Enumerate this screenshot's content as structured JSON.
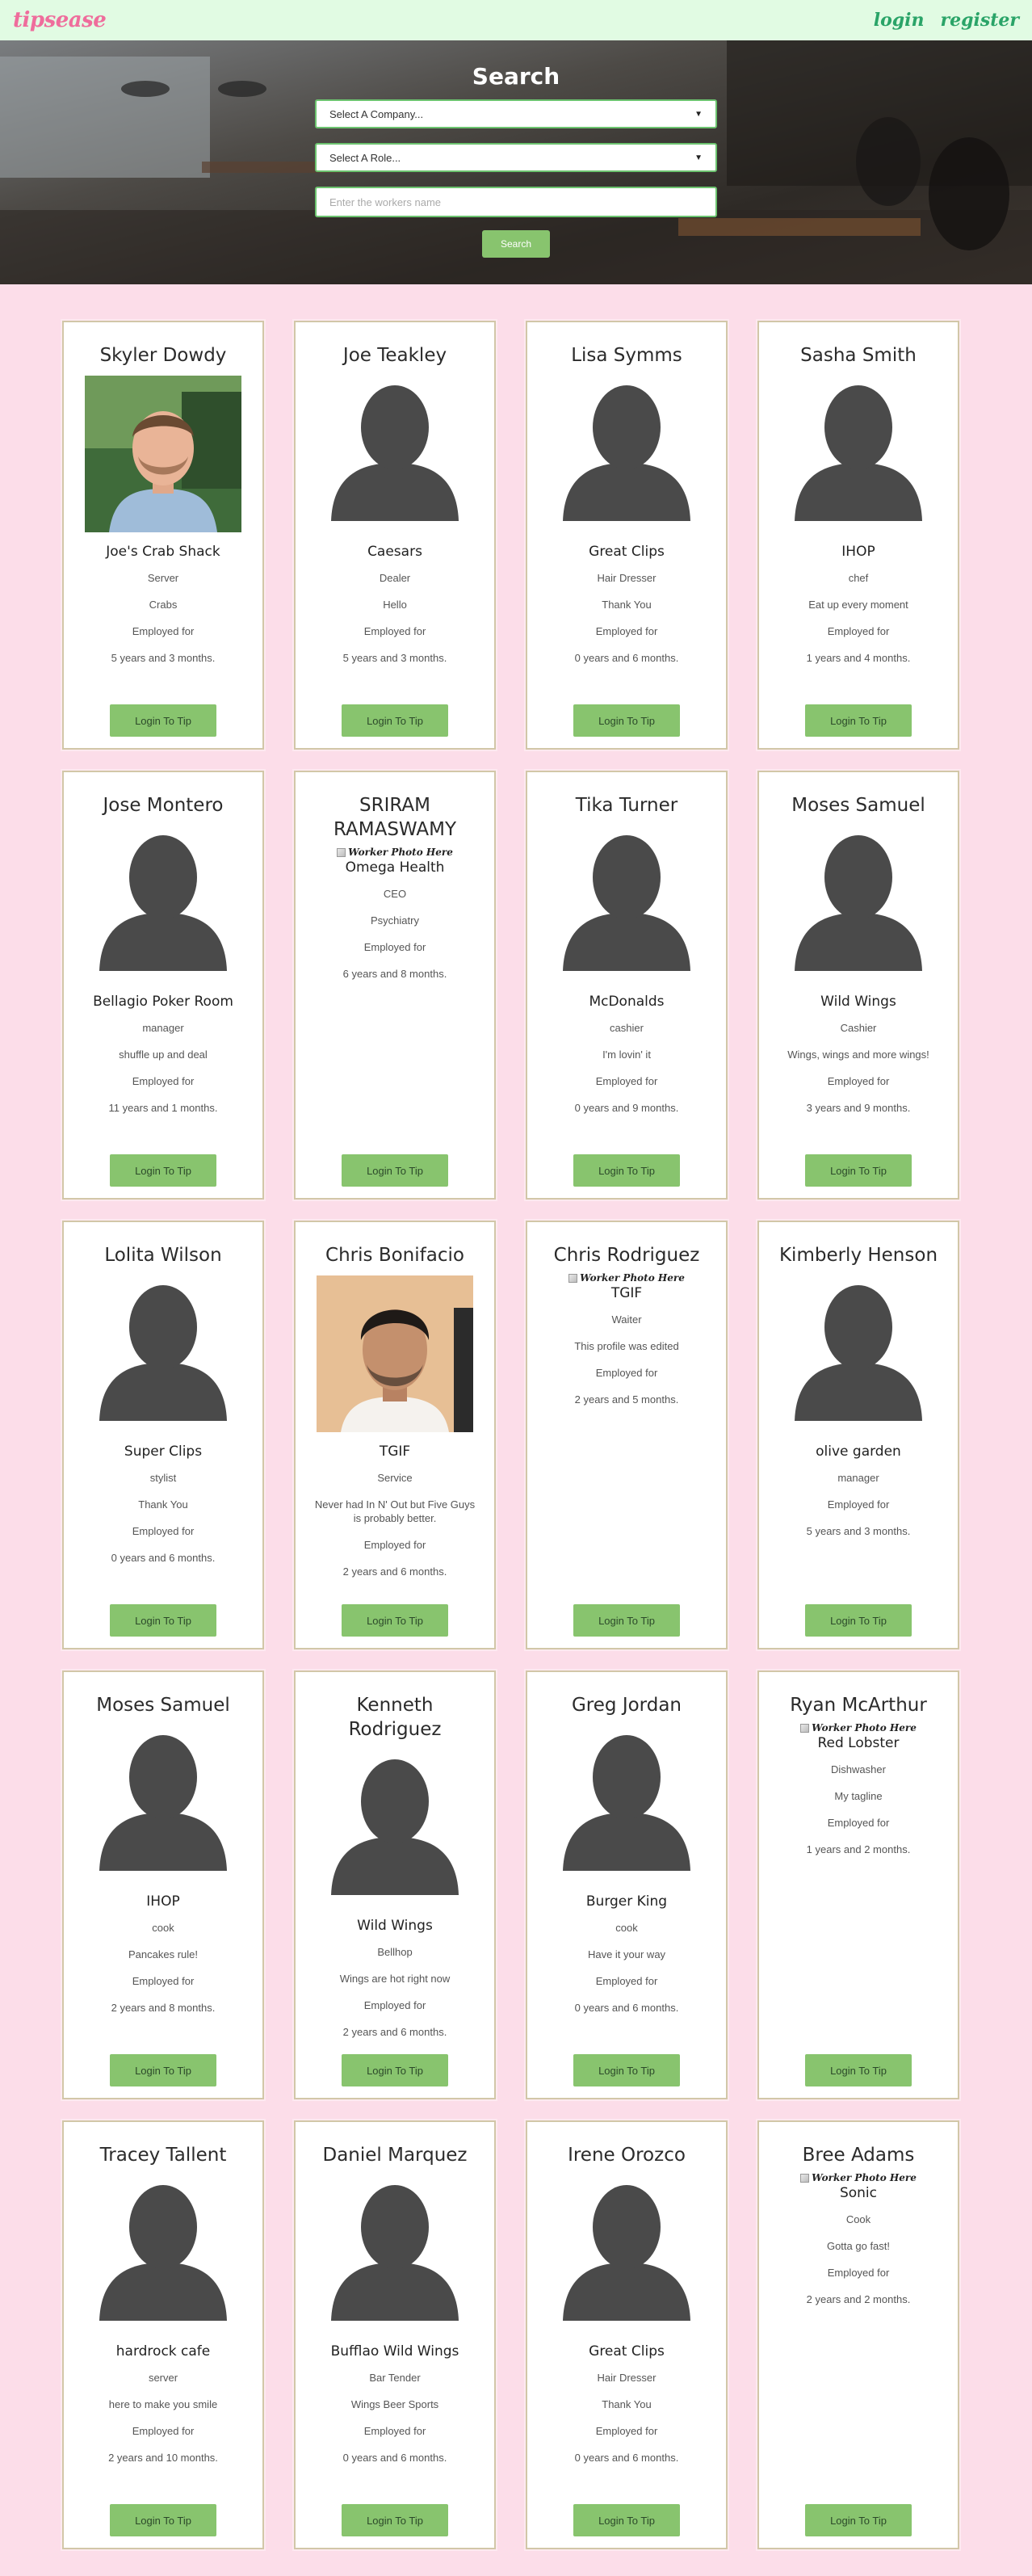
{
  "nav": {
    "brand": "tipsease",
    "login": "login",
    "register": "register"
  },
  "search": {
    "title": "Search",
    "company_select": "Select A Company...",
    "role_select": "Select A Role...",
    "name_placeholder": "Enter the workers name",
    "button": "Search"
  },
  "photo_alt": "Worker Photo Here",
  "labels": {
    "employed": "Employed for",
    "tip_button": "Login To Tip"
  },
  "workers": [
    {
      "name": "Skyler Dowdy",
      "photo": "portrait-a",
      "company": "Joe's Crab Shack",
      "lines": [
        "Server",
        "Crabs"
      ],
      "duration": "5 years and 3 months."
    },
    {
      "name": "Joe Teakley",
      "photo": "placeholder",
      "company": "Caesars",
      "lines": [
        "Dealer",
        "Hello"
      ],
      "duration": "5 years and 3 months."
    },
    {
      "name": "Lisa Symms",
      "photo": "placeholder",
      "company": "Great Clips",
      "lines": [
        "Hair Dresser",
        "Thank You"
      ],
      "duration": "0 years and 6 months."
    },
    {
      "name": "Sasha Smith",
      "photo": "placeholder",
      "company": "IHOP",
      "lines": [
        "chef",
        "Eat up every moment"
      ],
      "duration": "1 years and 4 months."
    },
    {
      "name": "Jose Montero",
      "photo": "placeholder",
      "company": "Bellagio Poker Room",
      "lines": [
        "manager",
        "shuffle up and deal"
      ],
      "duration": "11 years and 1 months."
    },
    {
      "name": "SRIRAM RAMASWAMY",
      "photo": "broken",
      "company": "Omega Health",
      "lines": [
        "CEO",
        "Psychiatry"
      ],
      "duration": "6 years and 8 months."
    },
    {
      "name": "Tika Turner",
      "photo": "placeholder",
      "company": "McDonalds",
      "lines": [
        "cashier",
        "I'm lovin' it"
      ],
      "duration": "0 years and 9 months."
    },
    {
      "name": "Moses Samuel",
      "photo": "placeholder",
      "company": "Wild Wings",
      "lines": [
        "Cashier",
        "Wings, wings and more wings!"
      ],
      "duration": "3 years and 9 months."
    },
    {
      "name": "Lolita Wilson",
      "photo": "placeholder",
      "company": "Super Clips",
      "lines": [
        "stylist",
        "Thank You"
      ],
      "duration": "0 years and 6 months."
    },
    {
      "name": "Chris Bonifacio",
      "photo": "portrait-b",
      "company": "TGIF",
      "lines": [
        "Service",
        "Never had In N' Out but Five Guys is probably better."
      ],
      "duration": "2 years and 6 months."
    },
    {
      "name": "Chris Rodriguez",
      "photo": "broken",
      "company": "TGIF",
      "lines": [
        "Waiter",
        "This profile was edited"
      ],
      "duration": "2 years and 5 months."
    },
    {
      "name": "Kimberly Henson",
      "photo": "placeholder",
      "company": "olive garden",
      "lines": [
        "manager"
      ],
      "duration": "5 years and 3 months."
    },
    {
      "name": "Moses Samuel",
      "photo": "placeholder",
      "company": "IHOP",
      "lines": [
        "cook",
        "Pancakes rule!"
      ],
      "duration": "2 years and 8 months."
    },
    {
      "name": "Kenneth Rodriguez",
      "photo": "placeholder",
      "company": "Wild Wings",
      "lines": [
        "Bellhop",
        "Wings are hot right now"
      ],
      "duration": "2 years and 6 months."
    },
    {
      "name": "Greg Jordan",
      "photo": "placeholder",
      "company": "Burger King",
      "lines": [
        "cook",
        "Have it your way"
      ],
      "duration": "0 years and 6 months."
    },
    {
      "name": "Ryan McArthur",
      "photo": "broken",
      "company": "Red Lobster",
      "lines": [
        "Dishwasher",
        "My tagline"
      ],
      "duration": "1 years and 2 months."
    },
    {
      "name": "Tracey Tallent",
      "photo": "placeholder",
      "company": "hardrock cafe",
      "lines": [
        "server",
        "here to make you smile"
      ],
      "duration": "2 years and 10 months."
    },
    {
      "name": "Daniel Marquez",
      "photo": "placeholder",
      "company": "Bufflao Wild Wings",
      "lines": [
        "Bar Tender",
        "Wings Beer Sports"
      ],
      "duration": "0 years and 6 months."
    },
    {
      "name": "Irene Orozco",
      "photo": "placeholder",
      "company": "Great Clips",
      "lines": [
        "Hair Dresser",
        "Thank You"
      ],
      "duration": "0 years and 6 months."
    },
    {
      "name": "Bree Adams",
      "photo": "broken",
      "company": "Sonic",
      "lines": [
        "Cook",
        "Gotta go fast!"
      ],
      "duration": "2 years and 2 months."
    }
  ]
}
